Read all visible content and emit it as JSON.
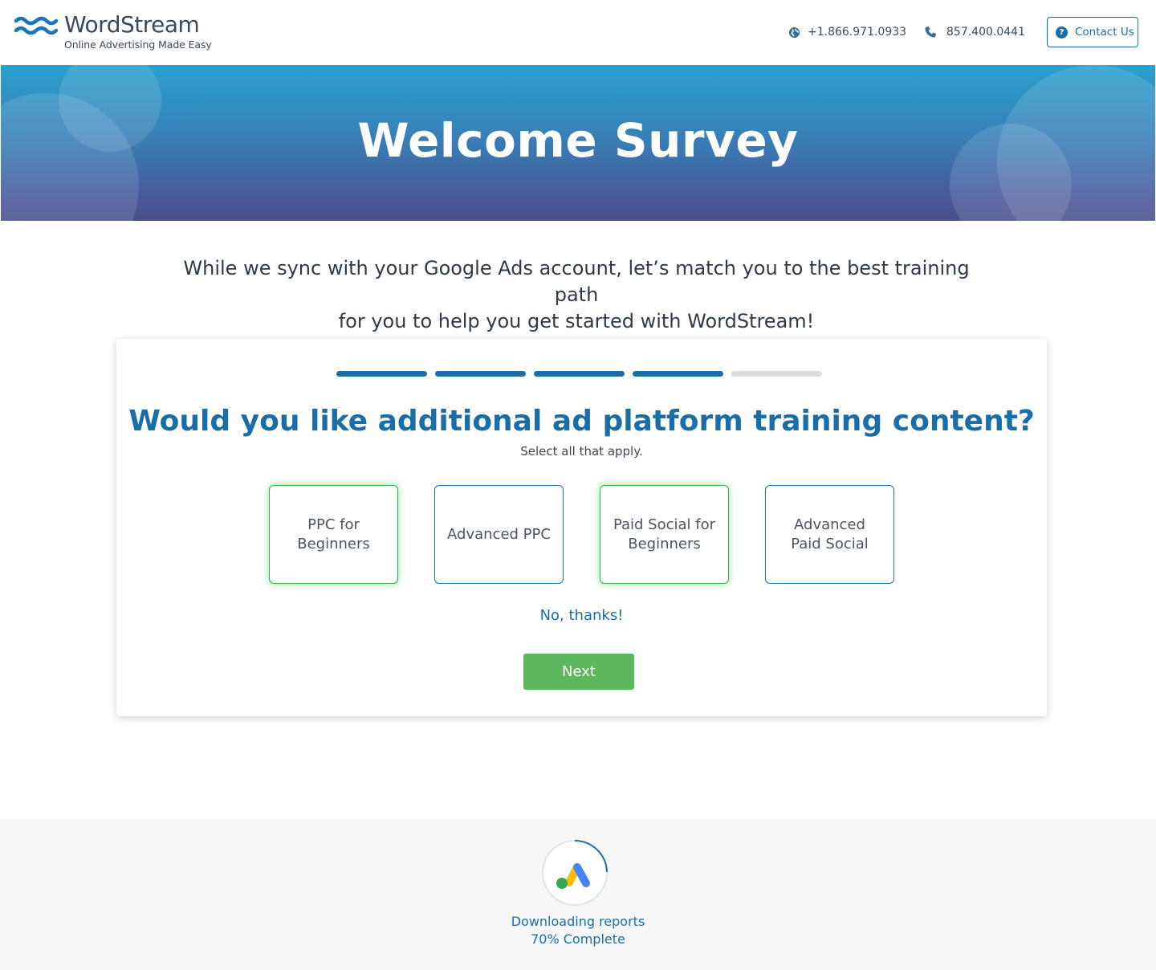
{
  "header": {
    "logo_name": "WordStream",
    "logo_tagline": "Online Advertising Made Easy",
    "phone_intl": "+1.866.971.0933",
    "phone_local": "857.400.0441",
    "contact_label": "Contact Us"
  },
  "banner": {
    "title": "Welcome Survey"
  },
  "intro": {
    "line1": "While we sync with your Google Ads account, let’s match you to the best training path",
    "line2": "for you to help you get started with WordStream!"
  },
  "survey": {
    "progress": {
      "total_steps": 5,
      "completed_steps": 4
    },
    "question": "Would you like additional ad platform training content?",
    "subtitle": "Select all that apply.",
    "options": [
      {
        "label": "PPC for Beginners",
        "selected": true
      },
      {
        "label": "Advanced PPC",
        "selected": false
      },
      {
        "label": "Paid Social for Beginners",
        "selected": true
      },
      {
        "label": "Advanced Paid Social",
        "selected": false
      }
    ],
    "decline_label": "No, thanks!",
    "next_label": "Next"
  },
  "footer": {
    "status_line1": "Downloading reports",
    "status_line2": "70% Complete",
    "percent_complete": 70,
    "icon": "google-ads-icon"
  },
  "colors": {
    "brand_blue": "#1a6ea8",
    "selected_green": "#35b04a",
    "next_green": "#5cb85c",
    "progress_todo": "#dcdcdc"
  }
}
